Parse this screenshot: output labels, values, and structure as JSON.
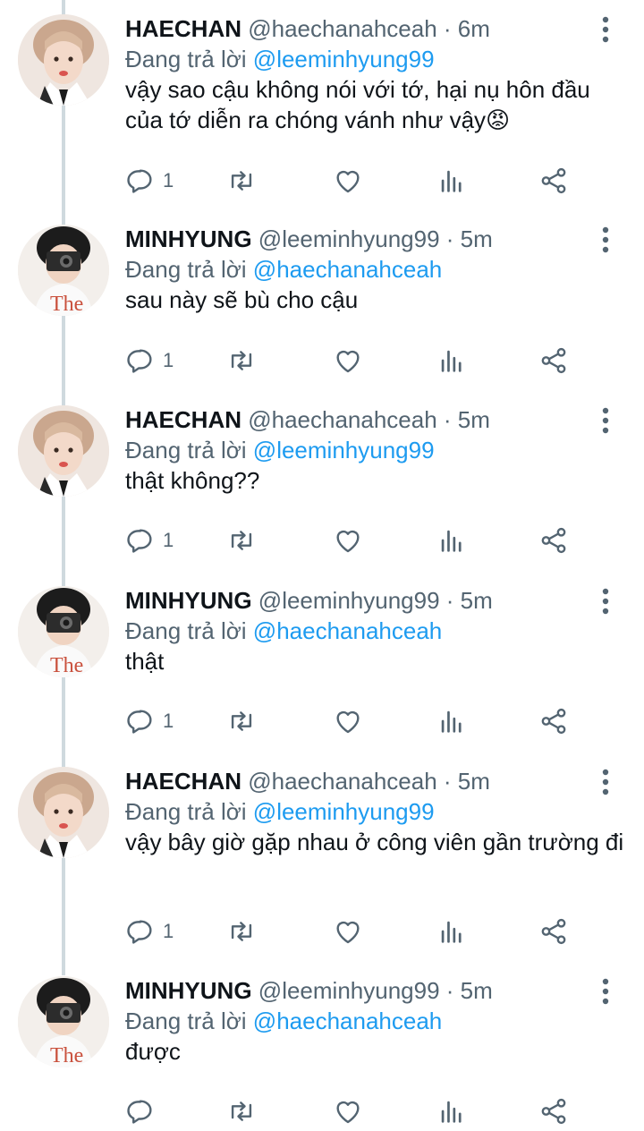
{
  "tweets": [
    {
      "name": "HAECHAN",
      "handle": "@haechanahceah",
      "time": "· 6m",
      "reply_prefix": "Đang trả lời",
      "reply_to": "@leeminhyung99",
      "text": "vậy sao cậu không nói với tớ, hại nụ hôn đầu của tớ diễn ra chóng vánh như vậy😡",
      "reply_count": "1",
      "avatar": "haechan"
    },
    {
      "name": "MINHYUNG",
      "handle": "@leeminhyung99",
      "time": "· 5m",
      "reply_prefix": "Đang trả lời",
      "reply_to": "@haechanahceah",
      "text": "sau này sẽ bù cho cậu",
      "reply_count": "1",
      "avatar": "minhyung"
    },
    {
      "name": "HAECHAN",
      "handle": "@haechanahceah",
      "time": "· 5m",
      "reply_prefix": "Đang trả lời",
      "reply_to": "@leeminhyung99",
      "text": "thật không??",
      "reply_count": "1",
      "avatar": "haechan"
    },
    {
      "name": "MINHYUNG",
      "handle": "@leeminhyung99",
      "time": "· 5m",
      "reply_prefix": "Đang trả lời",
      "reply_to": "@haechanahceah",
      "text": "thật",
      "reply_count": "1",
      "avatar": "minhyung"
    },
    {
      "name": "HAECHAN",
      "handle": "@haechanahceah",
      "time": "· 5m",
      "reply_prefix": "Đang trả lời",
      "reply_to": "@leeminhyung99",
      "text": "vậy bây giờ gặp nhau ở công viên gần trường đi",
      "reply_count": "1",
      "avatar": "haechan"
    },
    {
      "name": "MINHYUNG",
      "handle": "@leeminhyung99",
      "time": "· 5m",
      "reply_prefix": "Đang trả lời",
      "reply_to": "@haechanahceah",
      "text": "được",
      "reply_count": "",
      "avatar": "minhyung"
    }
  ],
  "icons": {
    "reply": "reply-icon",
    "retweet": "retweet-icon",
    "like": "heart-icon",
    "views": "views-icon",
    "share": "share-icon",
    "more": "more-icon"
  },
  "colors": {
    "mention": "#1d9bf0",
    "secondary": "#536471",
    "text": "#0f1419",
    "thread": "#cfd9de"
  }
}
